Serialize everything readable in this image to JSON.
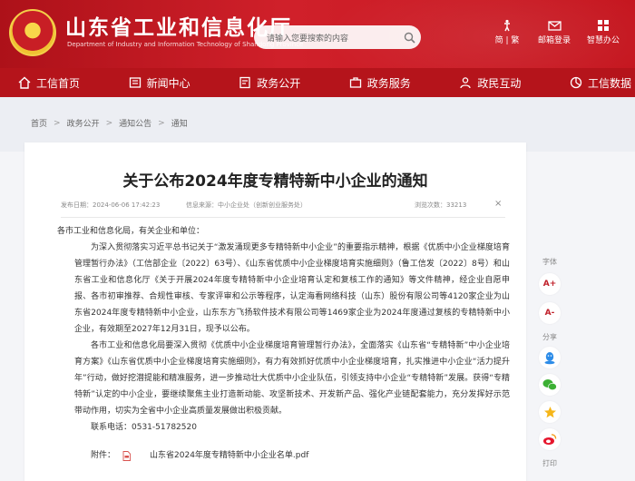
{
  "header": {
    "title": "山东省工业和信息化厅",
    "subtitle": "Department of Industry and Information Technology of Shandong Province",
    "search_placeholder": "请输入您要搜索的内容",
    "tools": [
      {
        "label": "简 | 繁",
        "icon": "text-icon"
      },
      {
        "label": "邮箱登录",
        "icon": "email-icon"
      },
      {
        "label": "智慧办公",
        "icon": "office-icon"
      }
    ],
    "accent_color": "#c81e25"
  },
  "nav": {
    "items": [
      {
        "label": "工信首页",
        "icon": "home-icon"
      },
      {
        "label": "新闻中心",
        "icon": "news-icon"
      },
      {
        "label": "政务公开",
        "icon": "gov-info-icon"
      },
      {
        "label": "政务服务",
        "icon": "service-icon"
      },
      {
        "label": "政民互动",
        "icon": "interaction-icon"
      },
      {
        "label": "工信数据",
        "icon": "data-icon"
      }
    ]
  },
  "breadcrumb": [
    "首页",
    "政务公开",
    "通知公告",
    "通知"
  ],
  "article": {
    "title": "关于公布2024年度专精特新中小企业的通知",
    "publish_time": "发布日期：2024-06-06 17:42:23",
    "source": "信息来源：中小企业处（创新创业服务处）",
    "views": "浏览次数：33213",
    "close_symbol": "×",
    "salutation": "各市工业和信息化局，有关企业和单位：",
    "para1": "为深入贯彻落实习近平总书记关于“激发涌现更多专精特新中小企业”的重要指示精神，根据《优质中小企业梯度培育管理暂行办法》（工信部企业〔2022〕63号）、《山东省优质中小企业梯度培育实施细则》（鲁工信发〔2022〕8号）和山东省工业和信息化厅《关于开展2024年度专精特新中小企业培育认定和复核工作的通知》等文件精神，经企业自愿申报、各市初审推荐、合规性审核、专家评审和公示等程序，认定海看网络科技（山东）股份有限公司等4120家企业为山东省2024年度专精特新中小企业，山东东方飞扬软件技术有限公司等1469家企业为2024年度通过复核的专精特新中小企业，有效期至2027年12月31日，现予以公布。",
    "para2": "各市工业和信息化局要深入贯彻《优质中小企业梯度培育管理暂行办法》，全面落实《山东省“专精特新”中小企业培育方案》《山东省优质中小企业梯度培育实施细则》，有力有效抓好优质中小企业梯度培育，扎实推进中小企业“活力提升年”行动，做好挖潜提能和精准服务，进一步推动壮大优质中小企业队伍，引领支持中小企业“专精特新”发展。获得“专精特新”认定的中小企业，要继续聚焦主业打造新动能、攻坚新技术、开发新产品、强化产业链配套能力，充分发挥好示范带动作用，切实为全省中小企业高质量发展做出积极贡献。",
    "contact": "联系电话：0531-51782520",
    "attachment_label": "附件：",
    "attachment_file": "山东省2024年度专精特新中小企业名单.pdf"
  },
  "sidebar": {
    "font_label": "字体",
    "font_increase": "A+",
    "font_decrease": "A-",
    "share_label": "分享",
    "share_items": [
      "qq-icon",
      "wechat-icon",
      "qzone-icon",
      "weibo-icon"
    ],
    "print_label": "打印"
  }
}
